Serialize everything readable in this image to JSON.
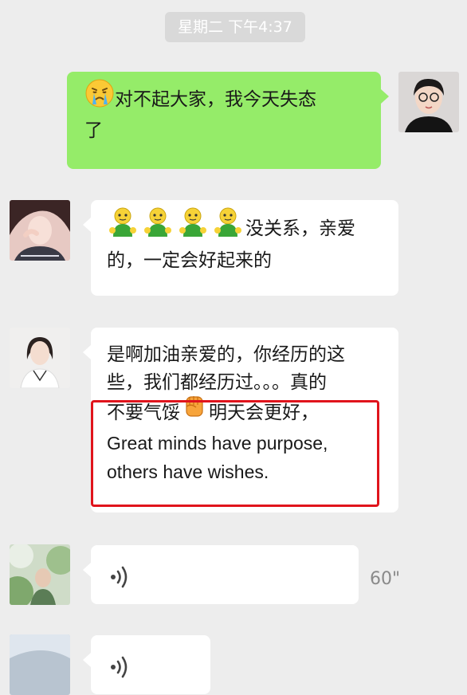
{
  "timestamp": "星期二 下午4:37",
  "messages": [
    {
      "text": "对不起大家，我今天失态了",
      "line1": "对不起大家，我今天失态",
      "line2": "了",
      "emoji": "crying-face"
    },
    {
      "line1": "没关系，亲爱",
      "line2": "的，一定会好起来的",
      "emoji": "strong-green-figure",
      "emoji_count": 4
    },
    {
      "line1": "是啊加油亲爱的，你经历的这",
      "line2": "些，我们都经历过。。。真的",
      "line3": "不要气馁",
      "line3b": "明天会更好，",
      "line4": "Great minds have purpose,",
      "line5": "others have wishes.",
      "emoji": "raised-fist"
    },
    {
      "type": "voice",
      "duration": "60\""
    },
    {
      "type": "voice",
      "duration": ""
    }
  ],
  "colors": {
    "background": "#ededed",
    "outgoing_bubble": "#95ec69",
    "incoming_bubble": "#ffffff",
    "highlight": "#e0141c"
  }
}
